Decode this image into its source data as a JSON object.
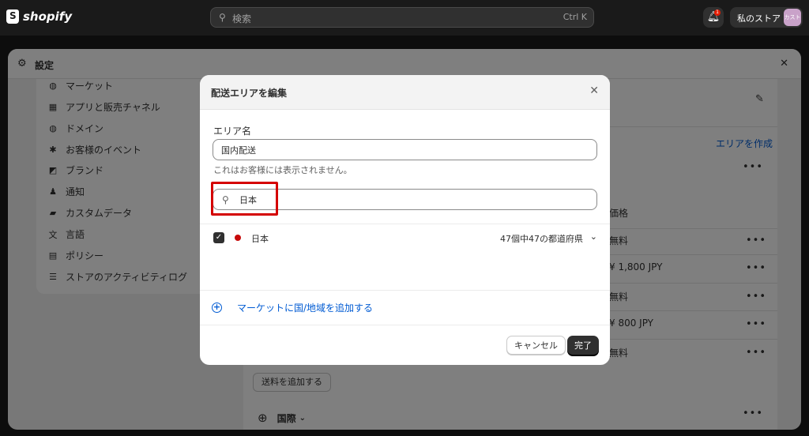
{
  "topbar": {
    "logo_text": "shopify",
    "search_placeholder": "検索",
    "search_shortcut": "Ctrl K",
    "notification_count": "1",
    "store_name": "私のストア",
    "avatar_text": "カスト"
  },
  "settings": {
    "title": "設定",
    "nav": [
      {
        "label": "マーケット",
        "icon": "globe-dollar-icon",
        "glyph": "◍"
      },
      {
        "label": "アプリと販売チャネル",
        "icon": "apps-icon",
        "glyph": "▦"
      },
      {
        "label": "ドメイン",
        "icon": "globe-icon",
        "glyph": "◍"
      },
      {
        "label": "お客様のイベント",
        "icon": "cursor-click-icon",
        "glyph": "✱"
      },
      {
        "label": "ブランド",
        "icon": "brand-icon",
        "glyph": "◩"
      },
      {
        "label": "通知",
        "icon": "bell-icon",
        "glyph": "♟"
      },
      {
        "label": "カスタムデータ",
        "icon": "data-icon",
        "glyph": "▰"
      },
      {
        "label": "言語",
        "icon": "language-icon",
        "glyph": "文"
      },
      {
        "label": "ポリシー",
        "icon": "policy-icon",
        "glyph": "▤"
      },
      {
        "label": "ストアのアクティビティログ",
        "icon": "list-icon",
        "glyph": "☰"
      }
    ],
    "main": {
      "create_area": "エリアを作成",
      "price_header": "価格",
      "rates": [
        "無料",
        "¥ 1,800 JPY",
        "無料",
        "¥ 800 JPY",
        "無料"
      ],
      "add_rate": "送料を追加する",
      "international": "国際"
    }
  },
  "modal": {
    "title": "配送エリアを編集",
    "zone_label": "エリア名",
    "zone_value": "国内配送",
    "zone_help": "これはお客様には表示されません。",
    "search_value": "日本",
    "country": {
      "name": "日本",
      "checked": true,
      "flag_color": "#c70a0a",
      "regions": "47個中47の都道府県"
    },
    "add_market": "マーケットに国/地域を追加する",
    "cancel": "キャンセル",
    "done": "完了"
  },
  "colors": {
    "accent_link": "#005bd3",
    "highlight_box": "#d40000",
    "primary_button": "#303030"
  }
}
